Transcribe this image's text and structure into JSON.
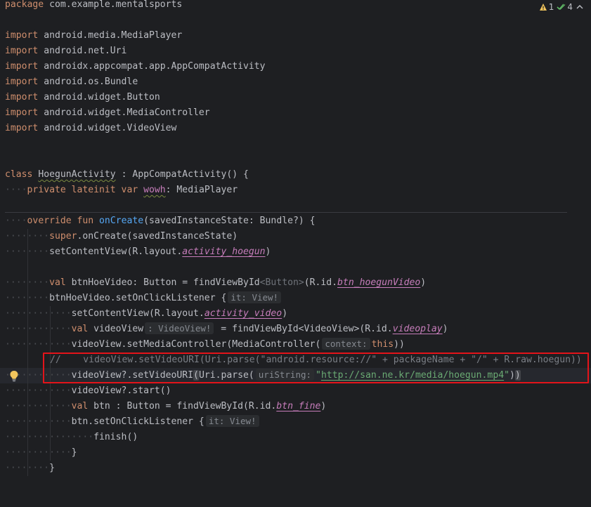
{
  "status": {
    "warnings": "1",
    "checks": "4"
  },
  "lines": {
    "l1": {
      "kw": "package",
      "rest": " com.example.mentalsports"
    },
    "imports": [
      {
        "kw": "import",
        "path": " android.media.MediaPlayer"
      },
      {
        "kw": "import",
        "path": " android.net.Uri"
      },
      {
        "kw": "import",
        "path": " androidx.appcompat.app.AppCompatActivity"
      },
      {
        "kw": "import",
        "path": " android.os.Bundle"
      },
      {
        "kw": "import",
        "path": " android.widget.Button"
      },
      {
        "kw": "import",
        "path": " android.widget.MediaController"
      },
      {
        "kw": "import",
        "path": " android.widget.VideoView"
      }
    ],
    "class_decl": {
      "kw": "class",
      "name": "HoegunActivity",
      "rest": " : AppCompatActivity() {"
    },
    "prop_decl": {
      "dots": "····",
      "kw": "private lateinit var",
      "name": "wowh",
      "rest": ": MediaPlayer"
    },
    "override": {
      "dots": "····",
      "kw": "override fun",
      "fn": "onCreate",
      "rest": "(savedInstanceState: Bundle?) {"
    },
    "super_call": {
      "dots": "········",
      "kw": "super",
      "rest": ".onCreate(savedInstanceState)"
    },
    "set_content": {
      "dots": "········",
      "pre": "setContentView(R.layout.",
      "ref": "activity_hoegun",
      "post": ")"
    },
    "btn_decl": {
      "dots": "········",
      "kw": "val",
      "pre": " btnHoeVideo: Button = findViewById",
      "generic": "<Button>",
      "mid": "(R.id.",
      "ref": "btn_hoegunVideo",
      "post": ")"
    },
    "btn_listener": {
      "dots": "········",
      "pre": "btnHoeVideo.setOnClickListener {",
      "hint": "it: View!"
    },
    "set_content2": {
      "dots": "············",
      "pre": "setContentView(R.layout.",
      "ref": "activity_video",
      "post": ")"
    },
    "video_decl": {
      "dots": "············",
      "kw": "val",
      "pre": " videoView",
      "hint": ": VideoView!",
      "mid": " = findViewById<VideoView>(R.id.",
      "ref": "videoplay",
      "post": ")"
    },
    "media_ctrl": {
      "dots": "············",
      "pre": "videoView.setMediaController(MediaController(",
      "hint": "context:",
      "kw": "this",
      "post": "))"
    },
    "commented": {
      "text": "//    videoView.setVideoURI(Uri.parse(\"android.resource://\" + packageName + \"/\" + R.raw.hoegun))"
    },
    "set_uri": {
      "dots": "············",
      "pre": "videoView?.setVideoURI",
      "paren": "(",
      "mid": "Uri.parse(",
      "hint": "uriString:",
      "q1": "\"",
      "url": "http://san.ne.kr/media/hoegun.mp4",
      "q2": "\"",
      "post": ")",
      "paren2": ")"
    },
    "start": {
      "dots": "············",
      "text": "videoView?.start()"
    },
    "btn2_decl": {
      "dots": "············",
      "kw": "val",
      "pre": " btn : Button = findViewById(R.id.",
      "ref": "btn_fine",
      "post": ")"
    },
    "btn2_listener": {
      "dots": "············",
      "pre": "btn.setOnClickListener {",
      "hint": "it: View!"
    },
    "finish": {
      "dots": "················",
      "text": "finish()"
    },
    "close1": {
      "dots": "············",
      "text": "}"
    },
    "close2": {
      "dots": "········",
      "text": "}"
    }
  },
  "colors": {
    "keyword": "#cf8e6d",
    "function": "#56a8f5",
    "string": "#6aab73",
    "property": "#c77dbb",
    "highlight_box": "#e3141a",
    "background": "#1e1f22"
  }
}
